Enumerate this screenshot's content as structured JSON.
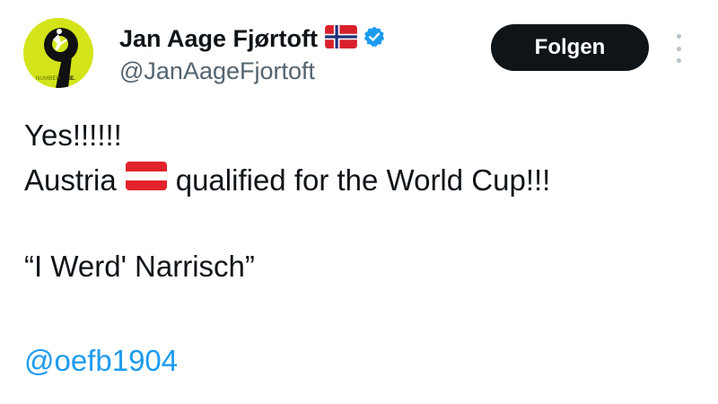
{
  "tweet": {
    "author": {
      "display_name": "Jan Aage Fjørtoft",
      "handle": "@JanAageFjortoft",
      "avatar_text": {
        "light": "NUMBER",
        "bold": "NINE."
      },
      "name_flag_icon": "norway-flag-icon",
      "verified_icon": "verified-badge-icon"
    },
    "follow_label": "Folgen",
    "more_icon": "more-options-icon",
    "text": {
      "line1": "Yes!!!!!!",
      "line2_before": "Austria",
      "line2_flag_icon": "austria-flag-icon",
      "line2_after": "qualified for the World Cup!!!",
      "line3": "“I Werd' Narrisch”",
      "mention": "@oefb1904"
    },
    "colors": {
      "text": "#0f1419",
      "secondary": "#536471",
      "link": "#1d9bf0",
      "verified": "#1d9bf0",
      "avatar_bg": "#d4e41a",
      "button_bg": "#0f1419"
    }
  }
}
